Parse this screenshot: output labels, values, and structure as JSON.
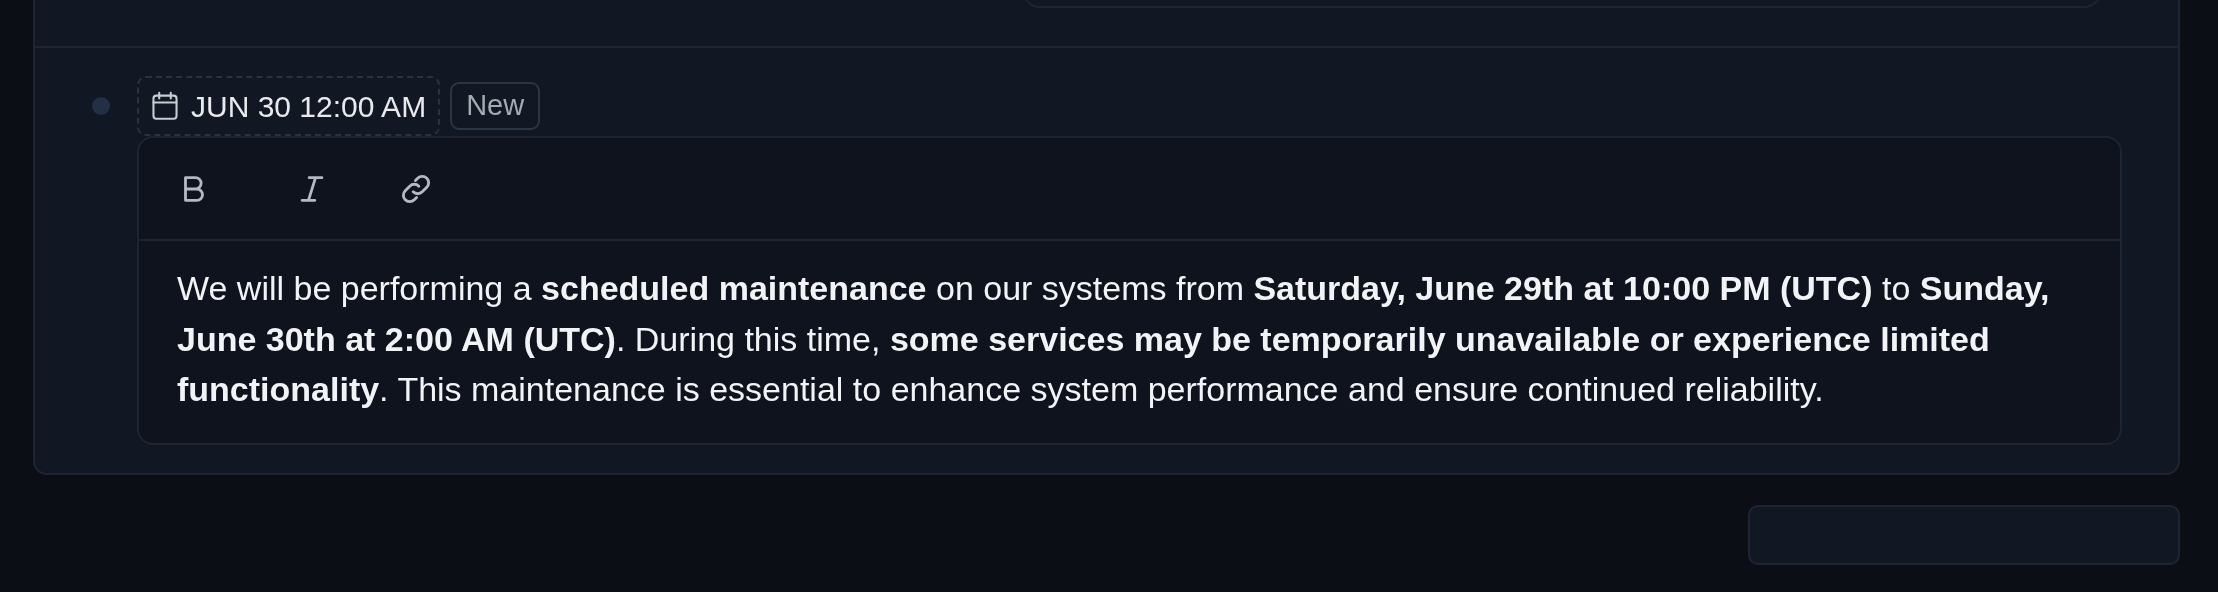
{
  "entry": {
    "date": "JUN 30 12:00 AM",
    "badge": "New",
    "toolbar": [
      {
        "kind": "bold"
      },
      {
        "kind": "italic"
      },
      {
        "kind": "link"
      }
    ],
    "text": "We will be performing a **scheduled maintenance** on our systems from **Saturday, June 29th at 10:00 PM (UTC)** to **Sunday, June 30th at 2:00 AM (UTC)**. During this time, **some services may be temporarily unavailable or experience limited functionality**. This maintenance is essential to enhance system performance and ensure continued reliability."
  }
}
